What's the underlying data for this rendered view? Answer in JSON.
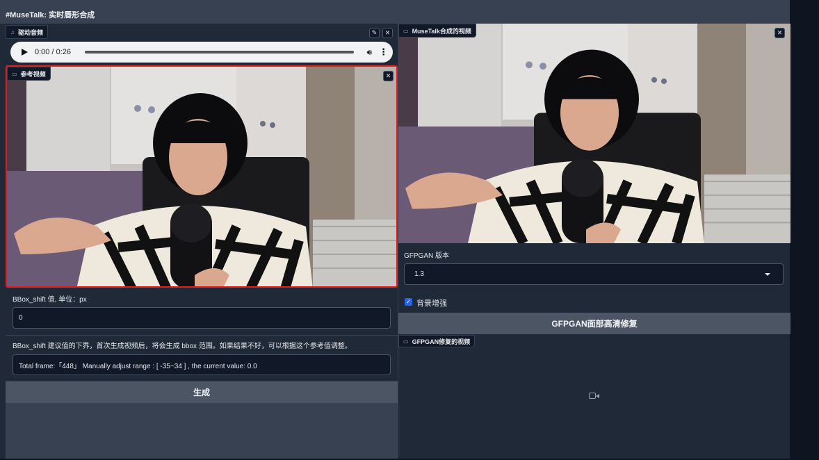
{
  "app_title": "#MuseTalk: 实时唇形合成",
  "left": {
    "audio": {
      "label": "驱动音频",
      "edit_icon": "pencil-icon",
      "close_icon": "close-icon",
      "time": "0:00 / 0:26",
      "play_icon": "play-icon",
      "volume_icon": "volume-icon",
      "more_icon": "more-vertical-icon"
    },
    "reference_video": {
      "label": "参考视频",
      "camera_icon": "video-camera-icon",
      "close_icon": "close-icon"
    },
    "bbox_shift": {
      "label": "BBox_shift 值, 单位：px",
      "value": "0"
    },
    "bbox_hint": {
      "label": "BBox_shift 建议值的下界，首次生成视频后，将会生成 bbox 范围。如果结果不好，可以根据这个参考值调整。",
      "value": "Total frame:「448」 Manually adjust range : [ -35~34 ] , the current value: 0.0"
    },
    "generate_button": "生成"
  },
  "right": {
    "output_video": {
      "label": "MuseTalk合成的视频",
      "close_icon": "close-icon"
    },
    "gfpgan_version": {
      "label": "GFPGAN 版本",
      "value": "1.3"
    },
    "bg_enhance": {
      "label": "背景增强",
      "checked": true
    },
    "restore_button": "GFPGAN面部高清修复",
    "restored_video": {
      "label": "GFPGAN修复的视频",
      "placeholder_icon": "video-camera-icon"
    }
  },
  "colors": {
    "accent_red": "#e11d1d",
    "checkbox_blue": "#2563eb",
    "panel_bg": "#1f2937",
    "button_bg": "#4b5563"
  }
}
